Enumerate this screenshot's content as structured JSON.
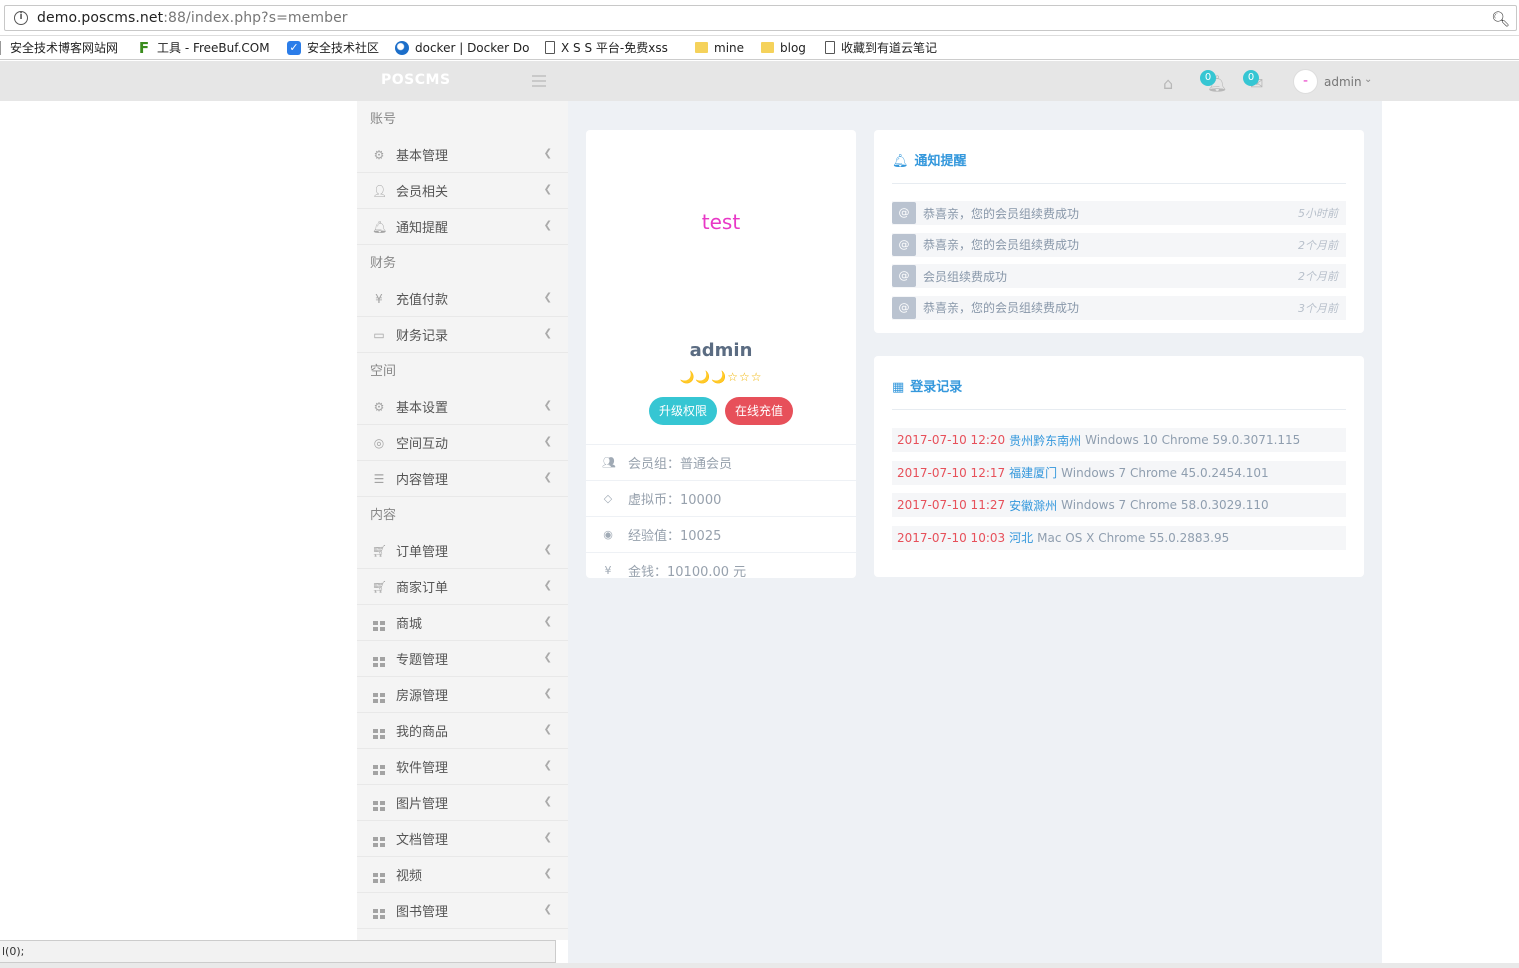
{
  "browser": {
    "url_host": "demo.poscms.net",
    "url_rest": ":88/index.php?s=member",
    "bookmarks": [
      {
        "label": "安全技术博客网站网",
        "icon": "none"
      },
      {
        "label": "工具 - FreeBuf.COM",
        "icon": "freebuf-icon"
      },
      {
        "label": "安全技术社区",
        "icon": "shield-icon"
      },
      {
        "label": "docker | Docker Do",
        "icon": "globe-icon"
      },
      {
        "label": "X S S 平台-免费xss",
        "icon": "page-icon"
      },
      {
        "label": "mine",
        "icon": "folder-icon"
      },
      {
        "label": "blog",
        "icon": "folder-icon"
      },
      {
        "label": "收藏到有道云笔记",
        "icon": "page-icon"
      }
    ]
  },
  "header": {
    "logo": "POSCMS",
    "notify_count": "0",
    "message_count": "0",
    "avatar_char": "-",
    "username": "admin"
  },
  "sidebar": {
    "sections": [
      {
        "title": "账号",
        "items": [
          {
            "label": "基本管理",
            "icon": "cogs-icon"
          },
          {
            "label": "会员相关",
            "icon": "user-icon"
          },
          {
            "label": "通知提醒",
            "icon": "bell-icon"
          }
        ]
      },
      {
        "title": "财务",
        "items": [
          {
            "label": "充值付款",
            "icon": "yen-icon"
          },
          {
            "label": "财务记录",
            "icon": "calendar-icon"
          }
        ]
      },
      {
        "title": "空间",
        "items": [
          {
            "label": "基本设置",
            "icon": "gear-icon"
          },
          {
            "label": "空间互动",
            "icon": "weibo-icon"
          },
          {
            "label": "内容管理",
            "icon": "database-icon"
          }
        ]
      },
      {
        "title": "内容",
        "items": [
          {
            "label": "订单管理",
            "icon": "cart-icon"
          },
          {
            "label": "商家订单",
            "icon": "cart-icon"
          },
          {
            "label": "商城",
            "icon": "grid-icon"
          },
          {
            "label": "专题管理",
            "icon": "grid-icon"
          },
          {
            "label": "房源管理",
            "icon": "grid-icon"
          },
          {
            "label": "我的商品",
            "icon": "grid-icon"
          },
          {
            "label": "软件管理",
            "icon": "grid-icon"
          },
          {
            "label": "图片管理",
            "icon": "grid-icon"
          },
          {
            "label": "文档管理",
            "icon": "grid-icon"
          },
          {
            "label": "视频",
            "icon": "grid-icon"
          },
          {
            "label": "图书管理",
            "icon": "grid-icon"
          }
        ]
      }
    ]
  },
  "profile": {
    "avatar_text": "test",
    "name": "admin",
    "level_icons": "🌙🌙🌙☆☆☆",
    "upgrade_label": "升级权限",
    "recharge_label": "在线充值",
    "stats": [
      {
        "icon": "users-icon",
        "text": "会员组：普通会员"
      },
      {
        "icon": "diamond-icon",
        "text": "虚拟币：10000"
      },
      {
        "icon": "compass-icon",
        "text": "经验值：10025"
      },
      {
        "icon": "yen-icon",
        "text": "金钱：10100.00 元"
      }
    ]
  },
  "notices": {
    "title": "通知提醒",
    "items": [
      {
        "text": "恭喜亲，您的会员组续费成功",
        "time": "5小时前"
      },
      {
        "text": "恭喜亲，您的会员组续费成功",
        "time": "2个月前"
      },
      {
        "text": "会员组续费成功",
        "time": "2个月前"
      },
      {
        "text": "恭喜亲，您的会员组续费成功",
        "time": "3个月前"
      }
    ]
  },
  "logins": {
    "title": "登录记录",
    "items": [
      {
        "date": "2017-07-10 12:20",
        "location": "贵州黔东南州",
        "agent": "Windows 10 Chrome 59.0.3071.115"
      },
      {
        "date": "2017-07-10 12:17",
        "location": "福建厦门",
        "agent": "Windows 7 Chrome 45.0.2454.101"
      },
      {
        "date": "2017-07-10 11:27",
        "location": "安徽滁州",
        "agent": "Windows 7 Chrome 58.0.3029.110"
      },
      {
        "date": "2017-07-10 10:03",
        "location": "河北",
        "agent": "Mac OS X Chrome 55.0.2883.95"
      }
    ]
  },
  "statusbar": {
    "text": "l(0);"
  },
  "colors": {
    "accent": "#3598dc",
    "teal": "#36c6d3",
    "red": "#e7505a",
    "avatar": "#e838c6"
  }
}
